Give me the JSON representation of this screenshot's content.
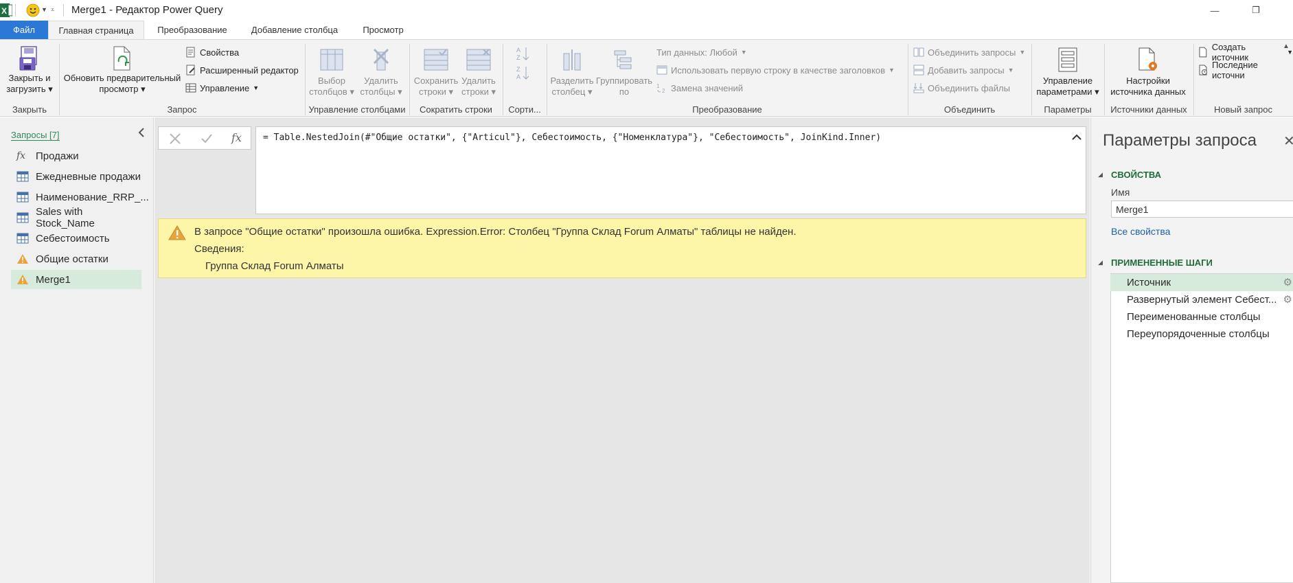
{
  "window": {
    "title": "Merge1 - Редактор Power Query",
    "minimize": "—",
    "restore": "❐"
  },
  "tabs": [
    "Файл",
    "Главная страница",
    "Преобразование",
    "Добавление столбца",
    "Просмотр"
  ],
  "ribbon": {
    "close": {
      "label1": "Закрыть и",
      "label2": "загрузить",
      "group": "Закрыть"
    },
    "query": {
      "refresh1": "Обновить предварительный",
      "refresh2": "просмотр",
      "properties": "Свойства",
      "advanced": "Расширенный редактор",
      "manage": "Управление",
      "group": "Запрос"
    },
    "columns": {
      "choose1": "Выбор",
      "choose2": "столбцов",
      "remove1": "Удалить",
      "remove2": "столбцы",
      "group": "Управление столбцами"
    },
    "rows": {
      "keep1": "Сохранить",
      "keep2": "строки",
      "remove1": "Удалить",
      "remove2": "строки",
      "group": "Сократить строки"
    },
    "sort": {
      "group": "Сорти..."
    },
    "transform": {
      "split1": "Разделить",
      "split2": "столбец",
      "group1": "Группировать",
      "group2": "по",
      "datatype": "Тип данных: Любой",
      "firstrow": "Использовать первую строку в качестве заголовков",
      "replace": "Замена значений",
      "group": "Преобразование"
    },
    "combine": {
      "merge": "Объединить запросы",
      "append": "Добавить запросы",
      "files": "Объединить файлы",
      "group": "Объединить"
    },
    "params": {
      "label1": "Управление",
      "label2": "параметрами",
      "group": "Параметры"
    },
    "datasource": {
      "label1": "Настройки",
      "label2": "источника данных",
      "group": "Источники данных"
    },
    "newquery": {
      "create": "Создать источник",
      "recent": "Последние источни",
      "group": "Новый запрос"
    }
  },
  "queries": {
    "header": "Запросы [7]",
    "items": [
      {
        "name": "Продажи",
        "icon": "fx-icon"
      },
      {
        "name": "Ежедневные продажи",
        "icon": "table-icon"
      },
      {
        "name": "Наименование_RRP_...",
        "icon": "table-icon"
      },
      {
        "name": "Sales with Stock_Name",
        "icon": "table-icon"
      },
      {
        "name": "Себестоимость",
        "icon": "table-icon"
      },
      {
        "name": "Общие остатки",
        "icon": "warning-icon"
      },
      {
        "name": "Merge1",
        "icon": "warning-icon"
      }
    ]
  },
  "formula": {
    "fx": "fx",
    "text": "= Table.NestedJoin(#\"Общие остатки\", {\"Articul\"}, Себестоимость, {\"Номенклатура\"}, \"Себестоимость\", JoinKind.Inner)"
  },
  "error": {
    "message": "В запросе \"Общие остатки\" произошла ошибка. Expression.Error: Столбец \"Группа Склад Forum Алматы\" таблицы не найден.",
    "details_label": "Сведения:",
    "details_value": "Группа Склад Forum Алматы"
  },
  "settings": {
    "title": "Параметры запроса",
    "properties_header": "СВОЙСТВА",
    "name_label": "Имя",
    "name_value": "Merge1",
    "all_props": "Все свойства",
    "steps_header": "ПРИМЕНЕННЫЕ ШАГИ",
    "steps": [
      "Источник",
      "Развернутый элемент Себест...",
      "Переименованные столбцы",
      "Переупорядоченные столбцы"
    ]
  },
  "colors": {
    "file_tab": "#2b78d6",
    "selected": "#d7ebdc",
    "error_bg": "#fdf5a8",
    "section_green": "#1f6b3a",
    "link_blue": "#1f5fa8",
    "warning": "#e8a33d"
  }
}
